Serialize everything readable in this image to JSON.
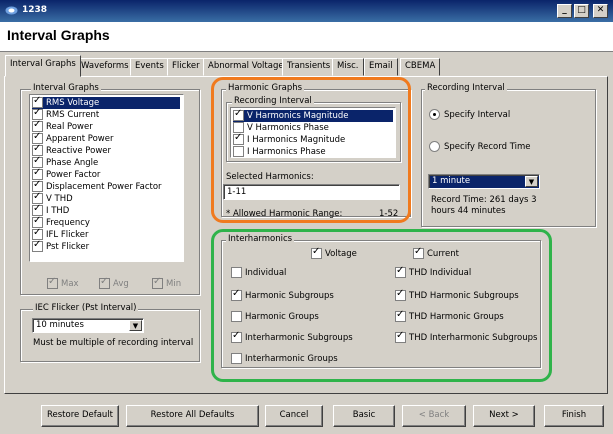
{
  "window": {
    "title": "1238",
    "header": "Interval Graphs",
    "min": "_",
    "max": "□",
    "close": "✕"
  },
  "tabs": [
    "Interval Graphs",
    "Waveforms",
    "Events",
    "Flicker",
    "Abnormal Voltage",
    "Transients",
    "Misc.",
    "Email",
    "CBEMA"
  ],
  "interval_graphs": {
    "title": "Interval Graphs",
    "items": [
      {
        "label": "RMS Voltage",
        "checked": true,
        "selected": true
      },
      {
        "label": "RMS Current",
        "checked": true
      },
      {
        "label": "Real Power",
        "checked": true
      },
      {
        "label": "Apparent Power",
        "checked": true
      },
      {
        "label": "Reactive Power",
        "checked": true
      },
      {
        "label": "Phase Angle",
        "checked": true
      },
      {
        "label": "Power Factor",
        "checked": true
      },
      {
        "label": "Displacement Power Factor",
        "checked": true
      },
      {
        "label": "V THD",
        "checked": true
      },
      {
        "label": "I THD",
        "checked": true
      },
      {
        "label": "Frequency",
        "checked": true
      },
      {
        "label": "IFL Flicker",
        "checked": true
      },
      {
        "label": "Pst Flicker",
        "checked": true
      }
    ],
    "max_label": "Max",
    "avg_label": "Avg",
    "min_label": "Min"
  },
  "iec_flicker": {
    "title": "IEC Flicker (Pst Interval)",
    "value": "10 minutes",
    "note": "Must be multiple of recording interval"
  },
  "harmonic_graphs": {
    "title": "Harmonic Graphs",
    "recording_interval_title": "Recording Interval",
    "items": [
      {
        "label": "V Harmonics Magnitude",
        "checked": true,
        "selected": true
      },
      {
        "label": "V Harmonics Phase",
        "checked": false
      },
      {
        "label": "I Harmonics Magnitude",
        "checked": true
      },
      {
        "label": "I Harmonics Phase",
        "checked": false
      }
    ],
    "selected_harmonics_label": "Selected Harmonics:",
    "selected_harmonics_value": "1-11",
    "allowed_range_label": "* Allowed Harmonic Range:",
    "allowed_range_value": "1-52"
  },
  "recording_interval": {
    "title": "Recording Interval",
    "specify_interval": "Specify Interval",
    "specify_record_time": "Specify Record Time",
    "interval_value": "1 minute",
    "record_time_line1": "Record Time: 261 days 3",
    "record_time_line2": "hours 44 minutes"
  },
  "interharmonics": {
    "title": "Interharmonics",
    "voltage": "Voltage",
    "current": "Current",
    "left": [
      {
        "label": "Individual",
        "checked": false
      },
      {
        "label": "Harmonic Subgroups",
        "checked": true
      },
      {
        "label": "Harmonic Groups",
        "checked": false
      },
      {
        "label": "Interharmonic Subgroups",
        "checked": true
      },
      {
        "label": "Interharmonic Groups",
        "checked": false
      }
    ],
    "right": [
      {
        "label": "THD Individual",
        "checked": true
      },
      {
        "label": "THD Harmonic Subgroups",
        "checked": true
      },
      {
        "label": "THD Harmonic Groups",
        "checked": true
      },
      {
        "label": "THD Interharmonic Subgroups",
        "checked": true
      }
    ]
  },
  "buttons": {
    "restore_default": "Restore Default",
    "restore_all": "Restore All Defaults",
    "cancel": "Cancel",
    "basic": "Basic",
    "back": "< Back",
    "next": "Next >",
    "finish": "Finish"
  },
  "colors": {
    "highlight_orange": "#f07a1e",
    "highlight_green": "#2fb34a",
    "selection": "#0a246a"
  }
}
